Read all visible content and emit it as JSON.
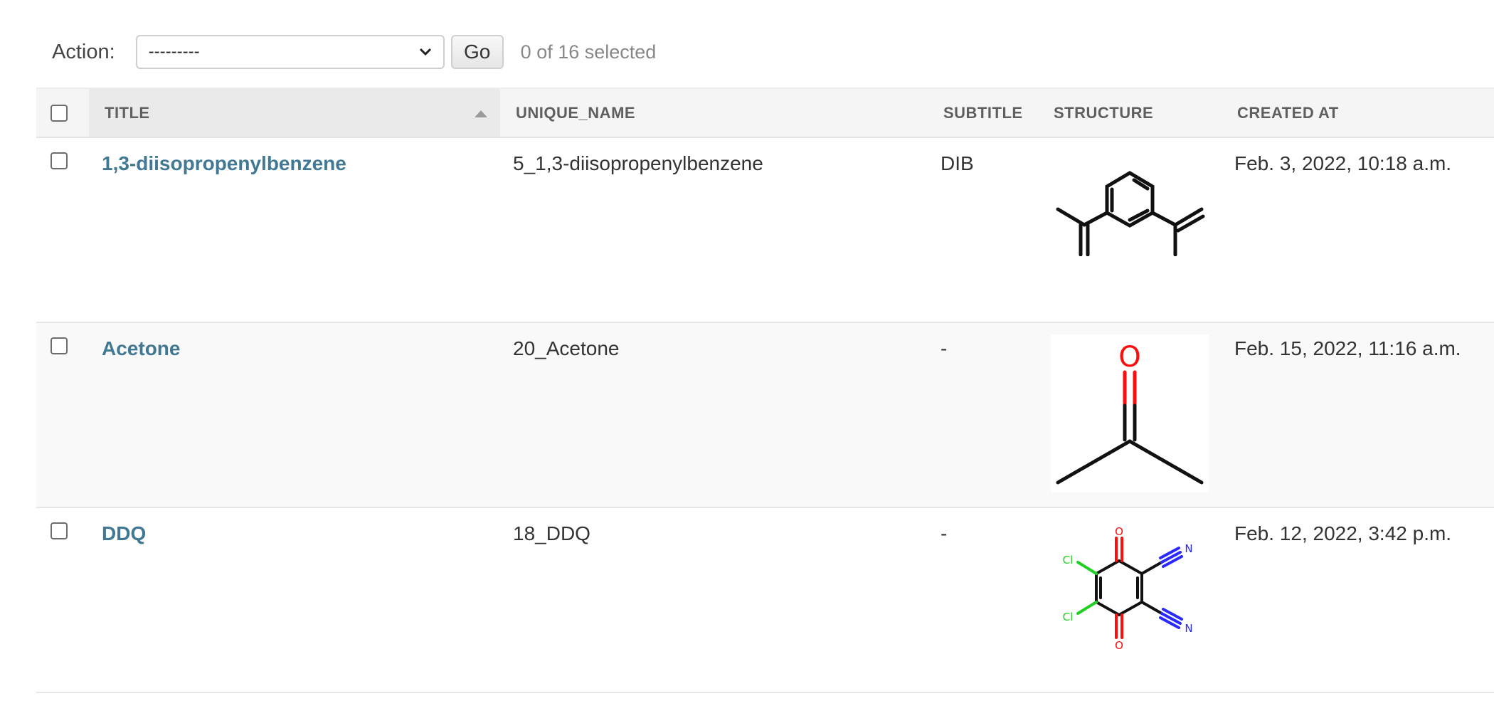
{
  "actions": {
    "label": "Action:",
    "select_value": "---------",
    "go_label": "Go",
    "counter": "0 of 16 selected"
  },
  "table": {
    "headers": {
      "title": "TITLE",
      "unique_name": "UNIQUE_NAME",
      "subtitle": "SUBTITLE",
      "structure": "STRUCTURE",
      "created_at": "CREATED AT"
    },
    "rows": [
      {
        "title": "1,3-diisopropenylbenzene",
        "unique_name": "5_1,3-diisopropenylbenzene",
        "subtitle": "DIB",
        "structure_icon": "1,3-diisopropenylbenzene-structure",
        "created_at": "Feb. 3, 2022, 10:18 a.m."
      },
      {
        "title": "Acetone",
        "unique_name": "20_Acetone",
        "subtitle": "-",
        "structure_icon": "acetone-structure",
        "structure_atoms": [
          "O"
        ],
        "created_at": "Feb. 15, 2022, 11:16 a.m."
      },
      {
        "title": "DDQ",
        "unique_name": "18_DDQ",
        "subtitle": "-",
        "structure_icon": "ddq-structure",
        "structure_atoms": [
          "O",
          "O",
          "Cl",
          "Cl",
          "N",
          "N"
        ],
        "created_at": "Feb. 12, 2022, 3:42 p.m."
      }
    ]
  },
  "colors": {
    "link": "#417893",
    "header_bg": "#f5f5f5",
    "oxygen": "#ff0d0d",
    "chlorine": "#1fd01f",
    "nitrogen": "#2a2aff"
  }
}
